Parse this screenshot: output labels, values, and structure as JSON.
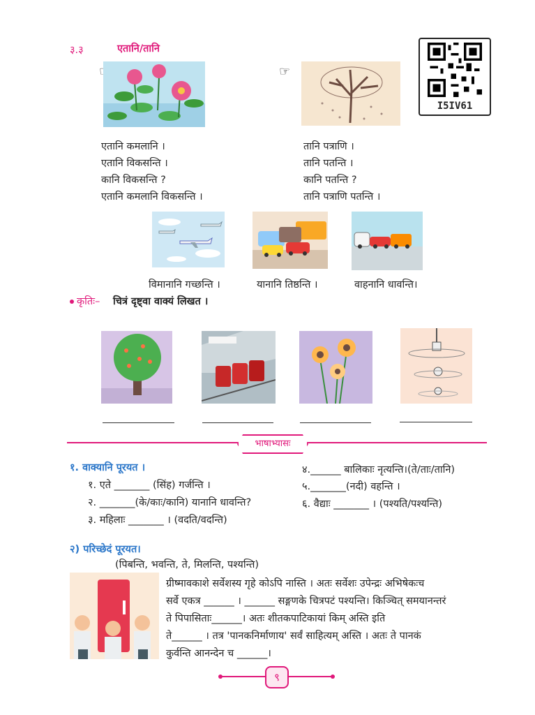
{
  "section": {
    "number": "३.३",
    "title": "एतानि/तानि"
  },
  "qr": {
    "code": "I5IV61"
  },
  "left_block": {
    "lines": [
      "एतानि कमलानि ।",
      "एतानि विकसन्ति ।",
      "कानि विकसन्ति ?",
      "एतानि कमलानि विकसन्ति ।"
    ]
  },
  "right_block": {
    "lines": [
      "तानि पत्राणि ।",
      "तानि पतन्ति ।",
      "कानि पतन्ति ?",
      "तानि पत्राणि पतन्ति ।"
    ]
  },
  "vehicles": {
    "captions": [
      "विमानानि गच्छन्ति ।",
      "यानानि तिष्ठन्ति ।",
      "वाहनानि धावन्ति।"
    ]
  },
  "activity": {
    "label": "कृतिः–",
    "text": "चित्रं दृष्ट्वा वाक्यं लिखत ।"
  },
  "practice": {
    "banner": "भाषाभ्यासः"
  },
  "q1": {
    "title": "१. वाक्यानि पूरयत ।",
    "items_left": [
      "१. एते _______ (सिंह) गर्जन्ति ।",
      "२. _______(के/काः/कानि) यानानि धावन्ति?",
      "३. महिलाः _______ । (वदति/वदन्ति)"
    ],
    "items_right": [
      "४.______ बालिकाः नृत्यन्ति।(ते/ताः/तानि)",
      "५._______(नदी) वहन्ति ।",
      "६. वैद्याः _______ । (पश्यति/पश्यन्ति)"
    ]
  },
  "q2": {
    "title": "२) परिच्छेदं पूरयत।",
    "options": "(पिबन्ति, भवन्ति, ते, मिलन्ति, पश्यन्ति)",
    "lines": [
      "ग्रीष्मावकाशे सर्वेशस्य गृहे कोऽपि नास्ति । अतः सर्वेशः उपेन्द्रः अभिषेकःच",
      "सर्वे एकत्र ______ । ______ सङ्गणके चित्रपटं पश्यन्ति। किञ्चित् समयानन्तरं",
      "ते पिपासिताः______। अतः शीतकपाटिकायां किम् अस्ति इति",
      "ते______ । तत्र 'पानकनिर्माणाय' सर्वं साहित्यम् अस्ति । अतः ते पानकं",
      "कुर्वन्ति आनन्देन च ______।"
    ]
  },
  "page_number": "९"
}
